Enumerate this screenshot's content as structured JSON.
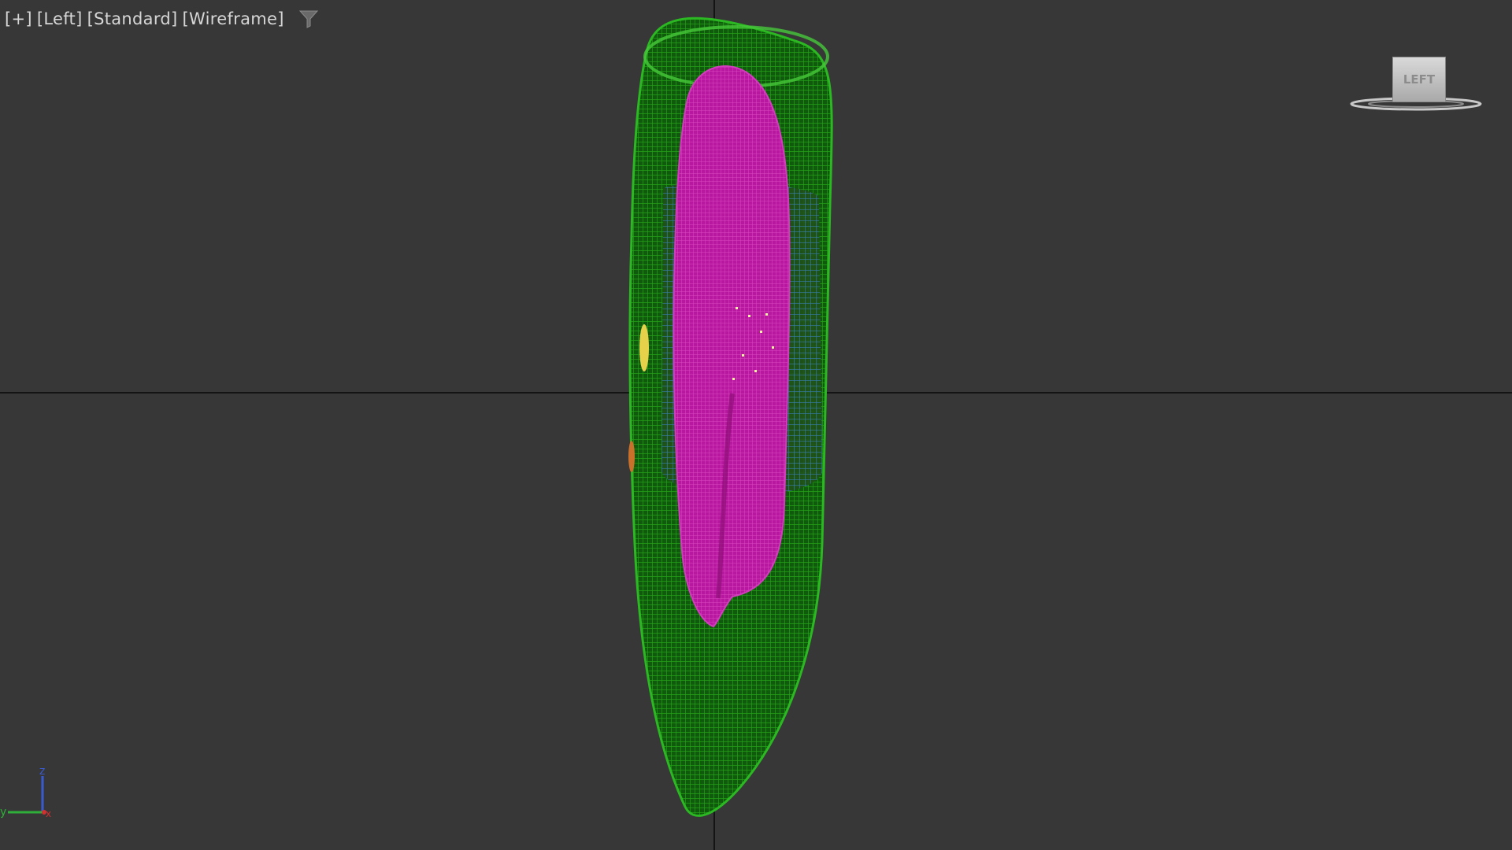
{
  "viewport": {
    "labels": [
      "[+]",
      "[Left]",
      "[Standard]",
      "[Wireframe]"
    ],
    "filter_icon": "funnel-filter-icon",
    "viewcube_face": "LEFT",
    "axis_labels": {
      "vertical": "z",
      "horizontal": "y",
      "depth": "x"
    }
  },
  "colors": {
    "background": "#373737",
    "outer_mesh": "#1c8a14",
    "inner_mesh": "#c21eaa",
    "mid_mesh": "#2a6fb0",
    "accent_yellow": "#e5d24a",
    "accent_orange": "#c9702a",
    "axis_z": "#3a5bd0",
    "axis_y": "#2fae3a",
    "axis_x": "#d03030"
  }
}
